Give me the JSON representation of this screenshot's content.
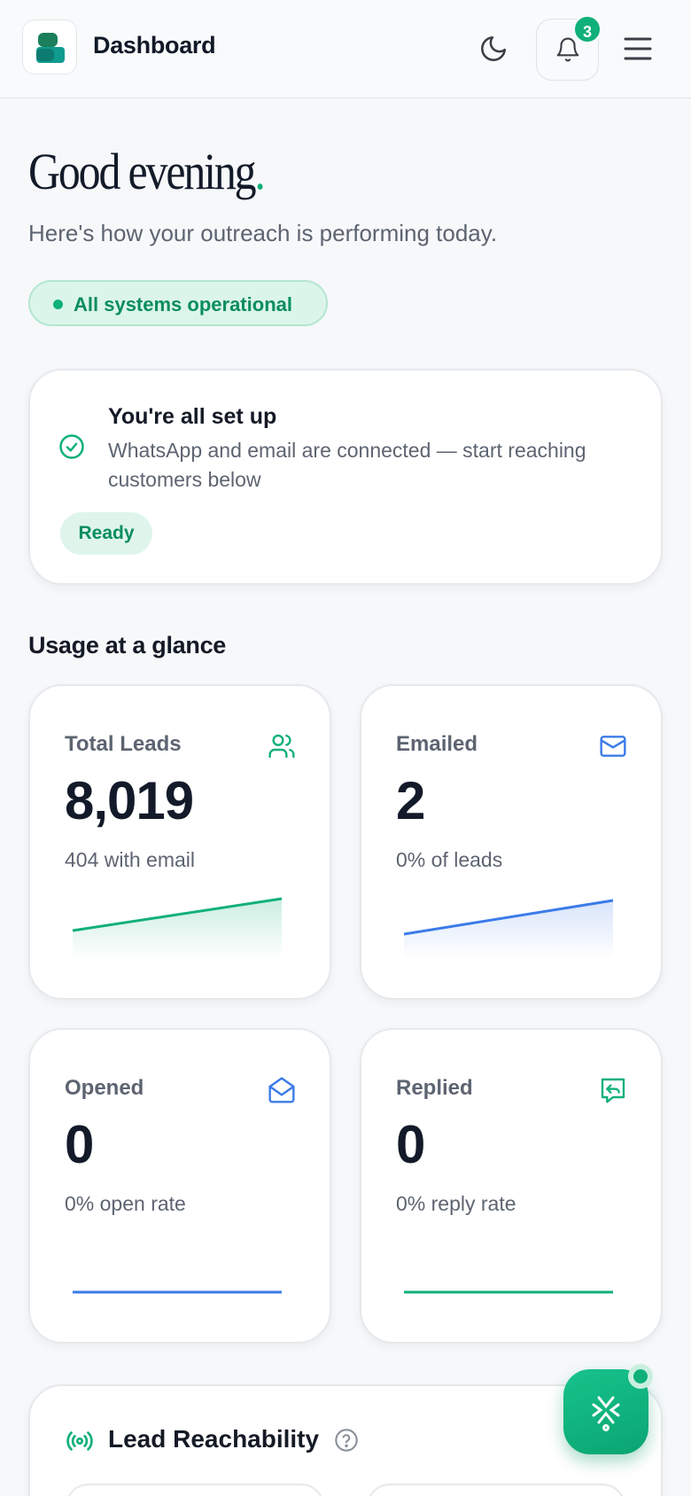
{
  "header": {
    "title": "Dashboard",
    "notification_count": "3",
    "icons": [
      "app-logo",
      "moon-icon",
      "bell-icon",
      "menu-icon"
    ]
  },
  "greeting": {
    "title": "Good evening",
    "dot": ".",
    "subtitle": "Here's how your outreach is performing today."
  },
  "status": {
    "label": "All systems operational"
  },
  "setup": {
    "title": "You're all set up",
    "description": "WhatsApp and email are connected — start reaching customers below",
    "badge": "Ready"
  },
  "usage": {
    "heading": "Usage at a glance",
    "stats": [
      {
        "label": "Total Leads",
        "value": "8,019",
        "note": "404 with email",
        "icon": "users-icon",
        "color": "#10b07a"
      },
      {
        "label": "Emailed",
        "value": "2",
        "note": "0% of leads",
        "icon": "mail-icon",
        "color": "#3b7be8"
      },
      {
        "label": "Opened",
        "value": "0",
        "note": "0% open rate",
        "icon": "mail-open-icon",
        "color": "#3b7be8"
      },
      {
        "label": "Replied",
        "value": "0",
        "note": "0% reply rate",
        "icon": "reply-icon",
        "color": "#10b07a"
      }
    ]
  },
  "reachability": {
    "title": "Lead Reachability"
  },
  "colors": {
    "accent": "#10b07a",
    "blue": "#3b7be8",
    "text": "#141a26",
    "muted": "#5d6471"
  }
}
